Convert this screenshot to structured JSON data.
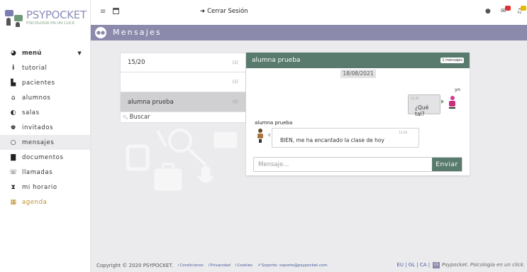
{
  "brand": {
    "name": "PSYPOCKET",
    "tagline": "PSICOLOGÍA EN UN CLICK"
  },
  "sidebar": {
    "items": [
      {
        "label": "menú",
        "icon": "speedometer-icon"
      },
      {
        "label": "tutorial",
        "icon": "info-icon"
      },
      {
        "label": "pacientes",
        "icon": "id-card-icon"
      },
      {
        "label": "alumnos",
        "icon": "university-icon"
      },
      {
        "label": "salas",
        "icon": "half-circle-icon"
      },
      {
        "label": "invitados",
        "icon": "guest-icon"
      },
      {
        "label": "mensajes",
        "icon": "chat-bubble-icon"
      },
      {
        "label": "documentos",
        "icon": "file-icon"
      },
      {
        "label": "llamadas",
        "icon": "phone-icon"
      },
      {
        "label": "mi horario",
        "icon": "hourglass-icon"
      },
      {
        "label": "agenda",
        "icon": "calendar-icon"
      }
    ]
  },
  "topbar": {
    "logout": "Cerrar Sesión"
  },
  "page": {
    "title": "Mensajes"
  },
  "conversations": [
    {
      "name": "15/20",
      "count": "(1)"
    },
    {
      "name": "",
      "count": "(1)"
    },
    {
      "name": "alumna prueba",
      "count": "(1)"
    }
  ],
  "search": {
    "label": "Buscar"
  },
  "chat": {
    "name": "alumna prueba",
    "message_count": "1 mensajes",
    "date": "18/08/2021",
    "outgoing": {
      "who": "yo",
      "time": "13:35",
      "text": "¿Qué tal?"
    },
    "incoming": {
      "sender": "alumna prueba",
      "time": "13:36",
      "text": "BIEN, me ha encantado la clase de hoy"
    },
    "input_placeholder": "Mensaje...",
    "send_label": "Enviar"
  },
  "footer": {
    "copyright": "Copyright © 2020 PSYPOCKET.",
    "links": [
      "Condiciones",
      "Privacidad",
      "Cookies",
      "Soporte: soporte@psypocket.com"
    ],
    "langs": "EU | GL | CA |",
    "lang_badge": "ES",
    "slogan": "Psypocket. Psicología en un click."
  },
  "colors": {
    "accent": "#8c8aac",
    "chat_header": "#587b6d",
    "badge_red": "#e03232",
    "badge_yellow": "#e8b800"
  }
}
